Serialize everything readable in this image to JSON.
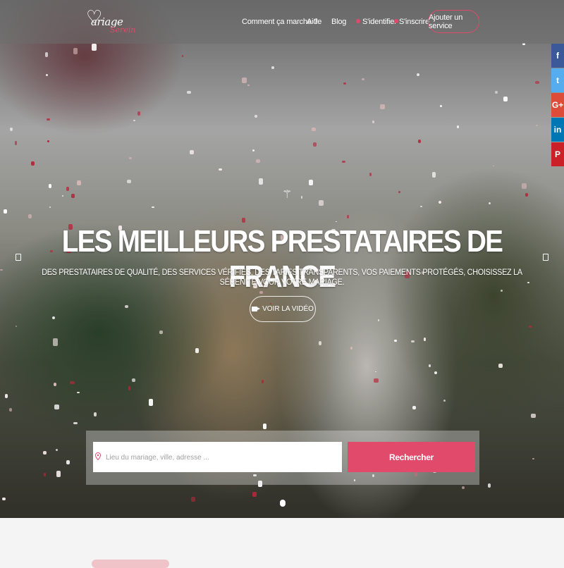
{
  "brand": {
    "logo_text": "ariage",
    "logo_sub": "Serein",
    "accent_color": "#e0496b",
    "logo_icon": "heart-icon"
  },
  "nav": {
    "how_it_works": "Comment ça marche ?",
    "help": "Aide",
    "blog": "Blog",
    "login": "S'identifier",
    "signup": "S'inscrire",
    "add_service": "Ajouter un service"
  },
  "social": [
    {
      "name": "facebook",
      "glyph": "f",
      "color": "#3b5998"
    },
    {
      "name": "twitter",
      "glyph": "t",
      "color": "#55acee"
    },
    {
      "name": "google-plus",
      "glyph": "G+",
      "color": "#dd4b39"
    },
    {
      "name": "linkedin",
      "glyph": "in",
      "color": "#0077b5"
    },
    {
      "name": "pinterest",
      "glyph": "P",
      "color": "#cb2027"
    }
  ],
  "hero": {
    "title": "LES MEILLEURS PRESTATAIRES DE FRANCE",
    "subtitle": "DES PRESTATAIRES DE QUALITÉ, DES SERVICES VÉRIFIÉS, DES TARIFS TRANSPARENTS, VOS PAIEMENTS PROTÉGÉS, CHOISISSEZ LA SÉRÉNITÉ VOUR VOTRE MARIAGE.",
    "video_button": "VOIR LA VIDÉO"
  },
  "search": {
    "placeholder": "Lieu du mariage, ville, adresse ...",
    "value": "",
    "button": "Rechercher"
  }
}
